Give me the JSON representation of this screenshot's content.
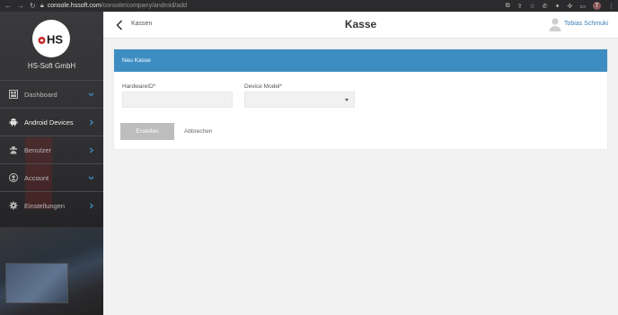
{
  "browser": {
    "url_host": "console.hssoft.com",
    "url_path": "/console/company/android/add",
    "profile_initial": "T"
  },
  "sidebar": {
    "logo_text": "HS",
    "company_name": "HS-Soft GmbH",
    "items": [
      {
        "label": "Dashboard",
        "icon": "dashboard-icon",
        "chevron": "down"
      },
      {
        "label": "Android Devices",
        "icon": "android-icon",
        "chevron": "right",
        "active": true
      },
      {
        "label": "Benutzer",
        "icon": "users-icon",
        "chevron": "right"
      },
      {
        "label": "Account",
        "icon": "account-icon",
        "chevron": "down"
      },
      {
        "label": "Einstellungen",
        "icon": "gear-icon",
        "chevron": "right"
      }
    ]
  },
  "header": {
    "back_label": "Kassen",
    "title": "Kasse",
    "user_name": "Tobias Schmuki"
  },
  "form": {
    "card_title": "Neu Kasse",
    "hardware_id_label": "HardwareID*",
    "hardware_id_value": "",
    "device_model_label": "Device Model*",
    "device_model_value": "",
    "create_label": "Erstellen",
    "cancel_label": "Abbrechen"
  },
  "colors": {
    "accent": "#3d8dc2",
    "user_link": "#3a7fb8",
    "sidebar_bg": "#2f2f31",
    "logo_red": "#c62828"
  }
}
